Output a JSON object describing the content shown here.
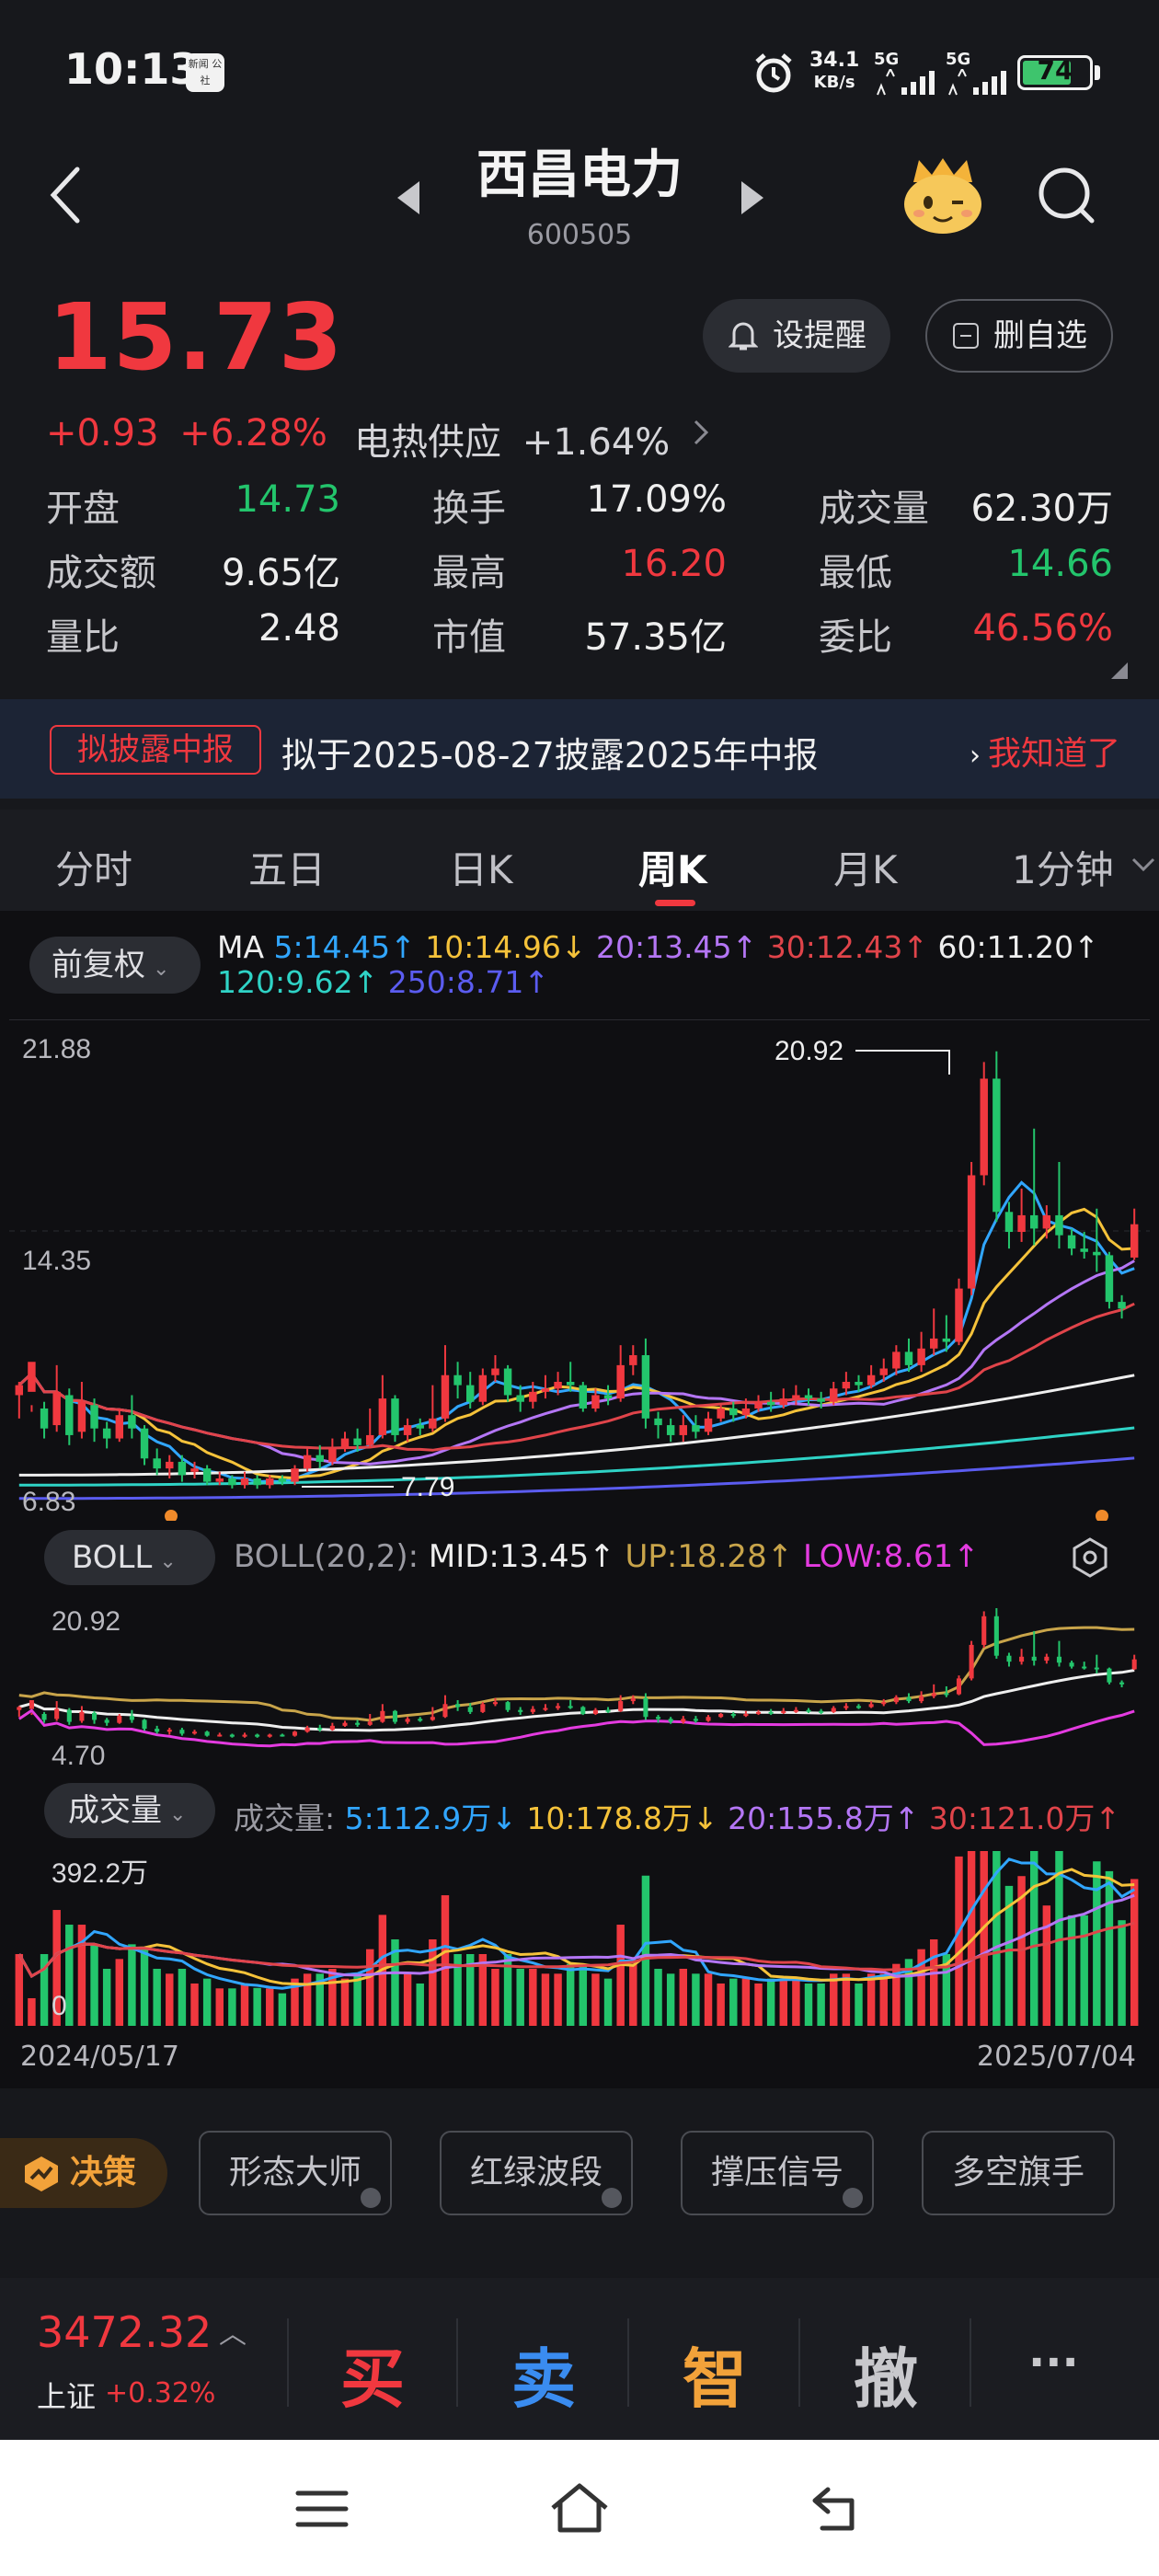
{
  "status_bar": {
    "time": "10:13",
    "news_badge": "新闻 公社",
    "net_speed_value": "34.1",
    "net_speed_unit": "KB/s",
    "signal_1": "5G",
    "signal_2": "5G",
    "battery": "74"
  },
  "header": {
    "stock_name": "西昌电力",
    "stock_code": "600505"
  },
  "quote": {
    "price": "15.73",
    "change": "+0.93",
    "change_pct": "+6.28%",
    "sector_name": "电热供应",
    "sector_change": "+1.64%",
    "alert_label": "设提醒",
    "watchlist_label": "删自选",
    "stats": [
      {
        "label": "开盘",
        "value": "14.73",
        "color": "#23c56c"
      },
      {
        "label": "换手",
        "value": "17.09%",
        "color": "#eeeeee"
      },
      {
        "label": "成交量",
        "value": "62.30万",
        "color": "#eeeeee"
      },
      {
        "label": "成交额",
        "value": "9.65亿",
        "color": "#eeeeee"
      },
      {
        "label": "最高",
        "value": "16.20",
        "color": "#f0383f"
      },
      {
        "label": "最低",
        "value": "14.66",
        "color": "#23c56c"
      },
      {
        "label": "量比",
        "value": "2.48",
        "color": "#eeeeee"
      },
      {
        "label": "市值",
        "value": "57.35亿",
        "color": "#eeeeee"
      },
      {
        "label": "委比",
        "value": "46.56%",
        "color": "#f0383f"
      }
    ]
  },
  "disclosure": {
    "tag": "拟披露中报",
    "text": "拟于2025-08-27披露2025年中报",
    "action": "我知道了"
  },
  "tabs": [
    {
      "label": "分时"
    },
    {
      "label": "五日"
    },
    {
      "label": "日K"
    },
    {
      "label": "周K",
      "active": true
    },
    {
      "label": "月K"
    },
    {
      "label": "1分钟"
    }
  ],
  "chart_header": {
    "adjust_label": "前复权",
    "ma_prefix": "MA",
    "ma_items": [
      {
        "text": "5:14.45↑",
        "color": "#31a6ff"
      },
      {
        "text": "10:14.96↓",
        "color": "#f5c23a"
      },
      {
        "text": "20:13.45↑",
        "color": "#b476f5"
      },
      {
        "text": "30:12.43↑",
        "color": "#e0444a"
      },
      {
        "text": "60:11.20↑",
        "color": "#eeeeee"
      },
      {
        "text": "120:9.62↑",
        "color": "#2fd3c6"
      },
      {
        "text": "250:8.71↑",
        "color": "#5b5cf0"
      }
    ]
  },
  "boll": {
    "button_label": "BOLL",
    "title": "BOLL(20,2):",
    "mid": "MID:13.45↑",
    "up": "UP:18.28↑",
    "low": "LOW:8.61↑",
    "axis_top": "20.92",
    "axis_bottom": "4.70"
  },
  "volume": {
    "button_label": "成交量",
    "title": "成交量:",
    "items": [
      {
        "text": "5:112.9万↓",
        "color": "#31a6ff"
      },
      {
        "text": "10:178.8万↓",
        "color": "#f5c23a"
      },
      {
        "text": "20:155.8万↑",
        "color": "#b476f5"
      },
      {
        "text": "30:121.0万↑",
        "color": "#e0444a"
      }
    ],
    "axis_top": "392.2万",
    "axis_bottom": "0"
  },
  "chart_data": {
    "type": "candlestick",
    "period": "周K",
    "y_axis_ticks": [
      "21.88",
      "14.35",
      "6.83"
    ],
    "ylim": [
      6.83,
      21.88
    ],
    "max_label": "20.92",
    "min_label": "7.79",
    "x_start": "2024/05/17",
    "x_end": "2025/07/04",
    "candles": [
      [
        10.6,
        10.9,
        9.9,
        11.0
      ],
      [
        10.7,
        11.6,
        10.1,
        10.3
      ],
      [
        10.2,
        9.6,
        9.3,
        10.4
      ],
      [
        9.7,
        10.7,
        9.5,
        11.5
      ],
      [
        10.6,
        9.4,
        9.1,
        10.8
      ],
      [
        9.5,
        10.4,
        9.3,
        11.0
      ],
      [
        10.3,
        9.6,
        9.2,
        10.5
      ],
      [
        9.6,
        9.3,
        9.0,
        9.8
      ],
      [
        9.3,
        10.0,
        9.2,
        10.2
      ],
      [
        10.0,
        9.6,
        9.3,
        10.6
      ],
      [
        9.6,
        8.7,
        8.5,
        9.7
      ],
      [
        8.7,
        8.4,
        8.2,
        9.0
      ],
      [
        8.4,
        8.6,
        8.1,
        8.8
      ],
      [
        8.6,
        8.2,
        8.0,
        8.8
      ],
      [
        8.3,
        8.4,
        8.1,
        8.6
      ],
      [
        8.4,
        8.0,
        7.9,
        8.5
      ],
      [
        8.0,
        8.1,
        7.9,
        8.3
      ],
      [
        8.1,
        7.9,
        7.8,
        8.2
      ],
      [
        7.9,
        8.1,
        7.8,
        8.3
      ],
      [
        8.1,
        7.9,
        7.79,
        8.2
      ],
      [
        7.9,
        8.1,
        7.8,
        8.2
      ],
      [
        8.1,
        8.0,
        7.9,
        8.2
      ],
      [
        8.0,
        8.4,
        7.9,
        8.5
      ],
      [
        8.4,
        8.8,
        8.3,
        9.0
      ],
      [
        8.8,
        8.6,
        8.4,
        9.1
      ],
      [
        8.6,
        9.0,
        8.5,
        9.3
      ],
      [
        9.0,
        9.3,
        8.9,
        9.5
      ],
      [
        9.3,
        9.1,
        8.9,
        9.6
      ],
      [
        9.1,
        9.4,
        9.0,
        10.2
      ],
      [
        9.4,
        10.5,
        9.3,
        11.2
      ],
      [
        10.5,
        9.4,
        9.2,
        10.6
      ],
      [
        9.4,
        9.7,
        9.2,
        9.9
      ],
      [
        9.7,
        9.6,
        9.4,
        9.9
      ],
      [
        9.6,
        9.9,
        9.5,
        10.9
      ],
      [
        9.9,
        11.2,
        9.8,
        12.1
      ],
      [
        11.2,
        10.9,
        10.5,
        11.6
      ],
      [
        10.9,
        10.4,
        10.2,
        11.3
      ],
      [
        10.4,
        11.2,
        10.3,
        11.4
      ],
      [
        11.2,
        11.4,
        11.0,
        11.8
      ],
      [
        11.4,
        10.6,
        10.4,
        11.5
      ],
      [
        10.6,
        10.4,
        10.1,
        10.9
      ],
      [
        10.4,
        10.7,
        10.2,
        11.0
      ],
      [
        10.7,
        10.8,
        10.5,
        11.2
      ],
      [
        10.8,
        11.0,
        10.6,
        11.3
      ],
      [
        11.0,
        10.9,
        10.7,
        11.6
      ],
      [
        10.9,
        10.2,
        10.1,
        11.0
      ],
      [
        10.2,
        10.6,
        10.1,
        10.8
      ],
      [
        10.6,
        10.5,
        10.3,
        10.9
      ],
      [
        10.5,
        11.5,
        10.4,
        12.1
      ],
      [
        11.5,
        11.8,
        11.2,
        12.1
      ],
      [
        11.8,
        9.9,
        9.6,
        12.3
      ],
      [
        9.9,
        9.7,
        9.3,
        10.1
      ],
      [
        9.7,
        9.4,
        9.2,
        9.9
      ],
      [
        9.4,
        9.7,
        9.2,
        10.0
      ],
      [
        9.7,
        9.5,
        9.3,
        10.0
      ],
      [
        9.5,
        9.9,
        9.4,
        10.1
      ],
      [
        9.9,
        10.2,
        9.8,
        10.3
      ],
      [
        10.2,
        10.0,
        9.8,
        10.4
      ],
      [
        10.0,
        10.2,
        9.9,
        10.5
      ],
      [
        10.2,
        10.4,
        10.1,
        10.6
      ],
      [
        10.4,
        10.3,
        10.1,
        10.7
      ],
      [
        10.3,
        10.5,
        10.2,
        10.8
      ],
      [
        10.5,
        10.6,
        10.3,
        10.9
      ],
      [
        10.6,
        10.5,
        10.3,
        10.8
      ],
      [
        10.5,
        10.4,
        10.2,
        10.7
      ],
      [
        10.4,
        10.8,
        10.3,
        11.0
      ],
      [
        10.8,
        11.0,
        10.6,
        11.3
      ],
      [
        11.0,
        10.9,
        10.7,
        11.2
      ],
      [
        10.9,
        11.2,
        10.8,
        11.5
      ],
      [
        11.2,
        11.4,
        11.0,
        11.7
      ],
      [
        11.4,
        11.9,
        11.2,
        12.1
      ],
      [
        11.9,
        11.5,
        11.3,
        12.3
      ],
      [
        11.5,
        12.0,
        11.3,
        12.5
      ],
      [
        12.0,
        12.3,
        11.8,
        13.2
      ],
      [
        12.3,
        12.2,
        11.9,
        13.0
      ],
      [
        12.2,
        13.8,
        12.1,
        14.1
      ],
      [
        13.8,
        17.2,
        13.6,
        17.6
      ],
      [
        17.2,
        20.1,
        16.9,
        20.6
      ],
      [
        20.1,
        16.1,
        15.8,
        20.92
      ],
      [
        16.1,
        15.5,
        15.0,
        16.4
      ],
      [
        15.5,
        16.0,
        15.2,
        16.8
      ],
      [
        16.0,
        15.6,
        15.1,
        18.6
      ],
      [
        15.6,
        16.0,
        15.3,
        16.3
      ],
      [
        16.0,
        15.4,
        15.0,
        17.6
      ],
      [
        15.4,
        15.0,
        14.8,
        15.6
      ],
      [
        15.0,
        14.9,
        14.7,
        15.5
      ],
      [
        14.9,
        14.8,
        14.3,
        16.2
      ],
      [
        14.8,
        13.4,
        13.2,
        14.9
      ],
      [
        13.4,
        13.2,
        12.9,
        13.6
      ],
      [
        14.73,
        15.73,
        14.66,
        16.2
      ]
    ]
  },
  "tools": {
    "decision_label": "决策",
    "buttons": [
      "形态大师",
      "红绿波段",
      "撑压信号",
      "多空旗手"
    ]
  },
  "trade_bar": {
    "index_value": "3472.32",
    "index_name": "上证",
    "index_change": "+0.32%",
    "buy": "买",
    "sell": "卖",
    "smart": "智",
    "cancel": "撤",
    "more": "···"
  }
}
